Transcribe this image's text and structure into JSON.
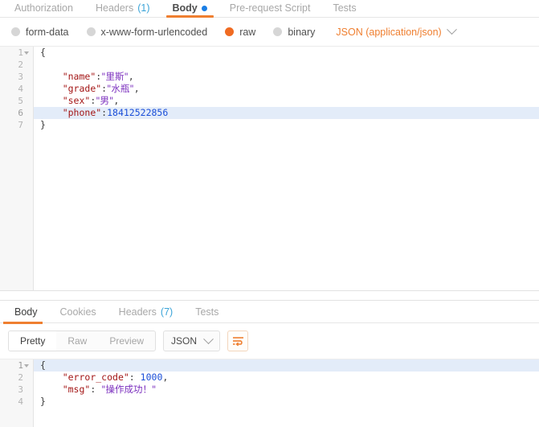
{
  "request_tabs": [
    {
      "label": "Authorization",
      "count": "",
      "active": false,
      "dot": false
    },
    {
      "label": "Headers",
      "count": "(1)",
      "active": false,
      "dot": false
    },
    {
      "label": "Body",
      "count": "",
      "active": true,
      "dot": true
    },
    {
      "label": "Pre-request Script",
      "count": "",
      "active": false,
      "dot": false
    },
    {
      "label": "Tests",
      "count": "",
      "active": false,
      "dot": false
    }
  ],
  "body_type": {
    "options": [
      {
        "label": "form-data",
        "selected": false
      },
      {
        "label": "x-www-form-urlencoded",
        "selected": false
      },
      {
        "label": "raw",
        "selected": true
      },
      {
        "label": "binary",
        "selected": false
      }
    ],
    "content_type": "JSON (application/json)",
    "chevron_icon": "chevron-down-icon"
  },
  "request_body": {
    "lines": [
      {
        "num": "1",
        "fold": true,
        "active": false,
        "text": "{"
      },
      {
        "num": "2",
        "fold": false,
        "active": false,
        "text": ""
      },
      {
        "num": "3",
        "fold": false,
        "active": false,
        "text": "    \"name\":\"里斯\","
      },
      {
        "num": "4",
        "fold": false,
        "active": false,
        "text": "    \"grade\":\"水瓶\","
      },
      {
        "num": "5",
        "fold": false,
        "active": false,
        "text": "    \"sex\":\"男\","
      },
      {
        "num": "6",
        "fold": false,
        "active": true,
        "text": "    \"phone\":18412522856"
      },
      {
        "num": "7",
        "fold": false,
        "active": false,
        "text": "}"
      }
    ]
  },
  "response_tabs": [
    {
      "label": "Body",
      "count": "",
      "active": true
    },
    {
      "label": "Cookies",
      "count": "",
      "active": false
    },
    {
      "label": "Headers",
      "count": "(7)",
      "active": false
    },
    {
      "label": "Tests",
      "count": "",
      "active": false
    }
  ],
  "response_toolbar": {
    "view_modes": [
      {
        "label": "Pretty",
        "active": true
      },
      {
        "label": "Raw",
        "active": false
      },
      {
        "label": "Preview",
        "active": false
      }
    ],
    "format": "JSON",
    "format_chevron_icon": "chevron-down-icon",
    "wrap_button_icon": "wrap-lines-icon"
  },
  "response_body": {
    "lines": [
      {
        "num": "1",
        "fold": true,
        "active": true,
        "text": "{"
      },
      {
        "num": "2",
        "fold": false,
        "active": false,
        "text": "    \"error_code\": 1000,"
      },
      {
        "num": "3",
        "fold": false,
        "active": false,
        "text": "    \"msg\": \"操作成功！\""
      },
      {
        "num": "4",
        "fold": false,
        "active": false,
        "text": "}"
      }
    ]
  },
  "colors": {
    "accent_orange": "#ef7f30",
    "radio_selected": "#f06b22",
    "blue_dot": "#1a7ee5",
    "count_blue": "#3ba4d8",
    "active_line": "#e3ecf9"
  }
}
